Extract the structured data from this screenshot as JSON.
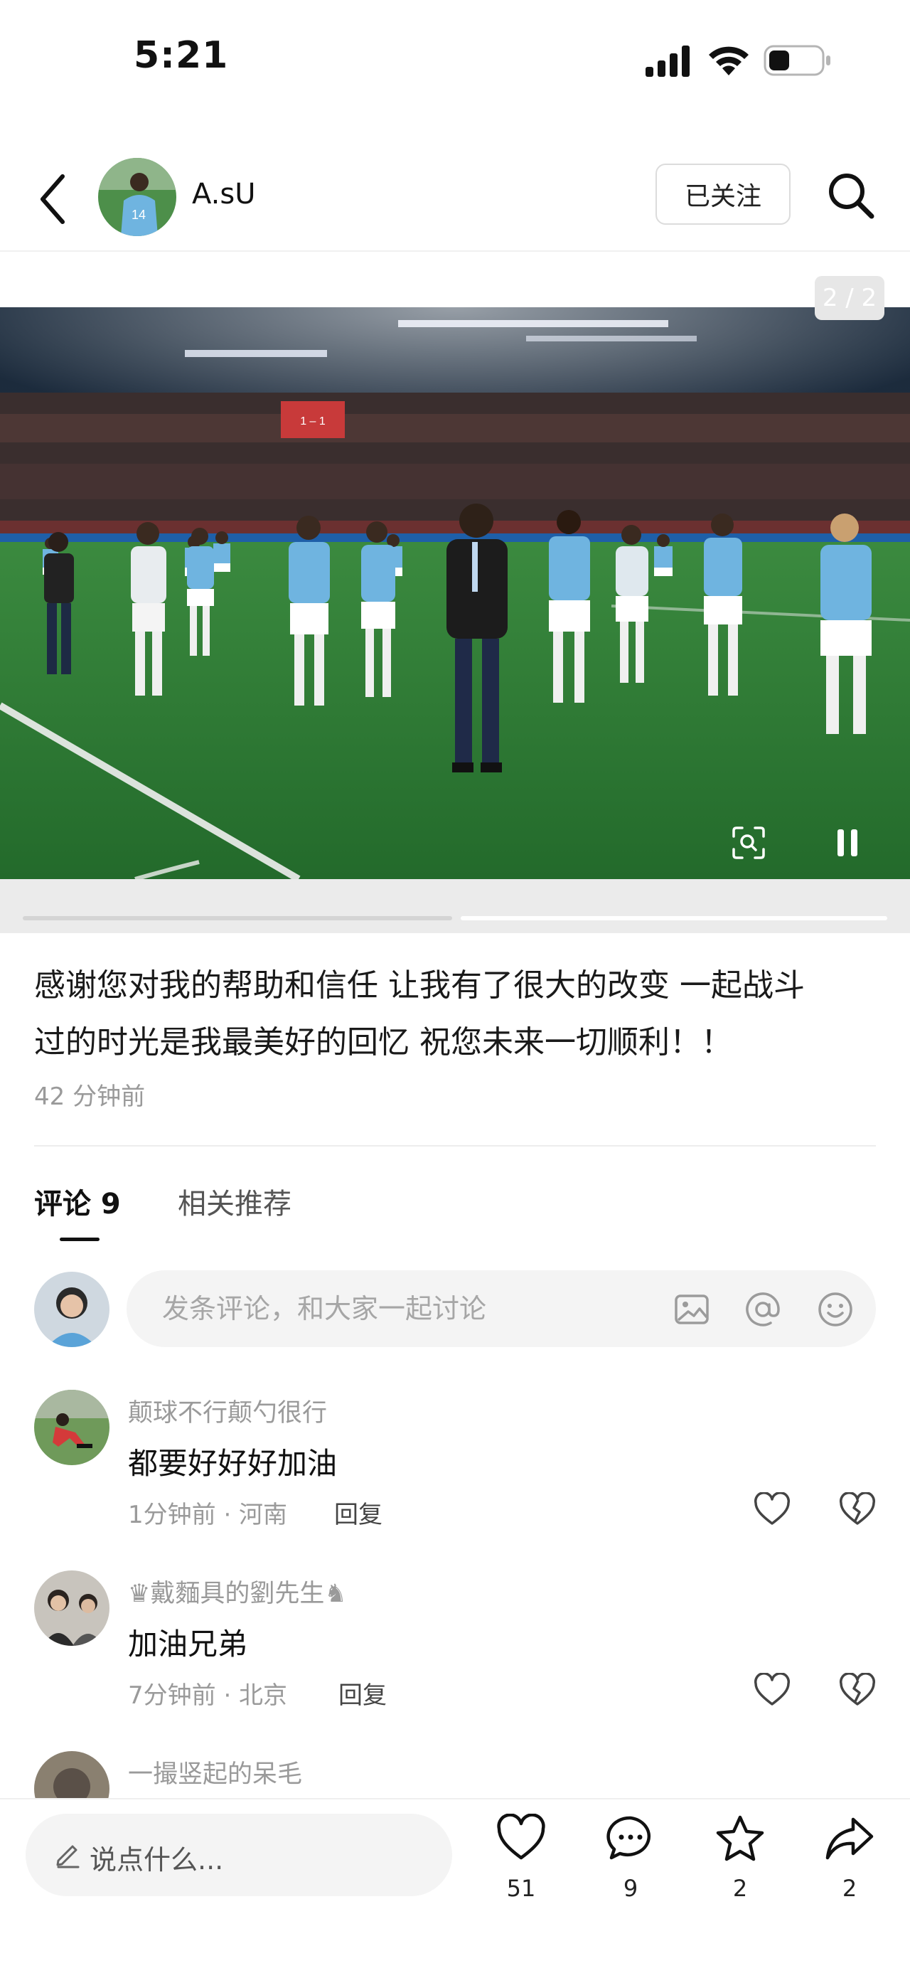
{
  "status_bar": {
    "time": "5:21"
  },
  "header": {
    "author_name": "A.sU",
    "follow_label": "已关注"
  },
  "photo": {
    "page_indicator": "2 / 2",
    "page_current": 2,
    "page_total": 2,
    "scoreboard_text": "1 – 1"
  },
  "post": {
    "caption": "感谢您对我的帮助和信任 让我有了很大的改变 一起战斗过的时光是我最美好的回忆 祝您未来一切顺利！！",
    "caption_line1": "感谢您对我的帮助和信任 让我有了很大的改变 一起战斗",
    "caption_line2": "过的时光是我最美好的回忆 祝您未来一切顺利！！",
    "time_ago": "42 分钟前"
  },
  "tabs": [
    {
      "label": "评论 9",
      "active": true
    },
    {
      "label": "相关推荐",
      "active": false
    }
  ],
  "comment_input": {
    "placeholder": "发条评论，和大家一起讨论"
  },
  "comments": [
    {
      "name": "颠球不行颠勺很行",
      "text": "都要好好好加油",
      "meta": "1分钟前 · 河南",
      "reply_label": "回复"
    },
    {
      "name": "♛戴麵具的劉先生♞",
      "text": "加油兄弟",
      "meta": "7分钟前 · 北京",
      "reply_label": "回复"
    },
    {
      "name": "一撮竖起的呆毛",
      "text": "",
      "meta": "",
      "reply_label": ""
    }
  ],
  "bottom_bar": {
    "say_placeholder": "说点什么...",
    "likes": "51",
    "comments": "9",
    "favorites": "2",
    "shares": "2"
  },
  "colors": {
    "jersey_blue": "#6fb4e0",
    "pitch_green": "#2f7a36",
    "text_primary": "#111111",
    "text_secondary": "#9a9a9a"
  }
}
